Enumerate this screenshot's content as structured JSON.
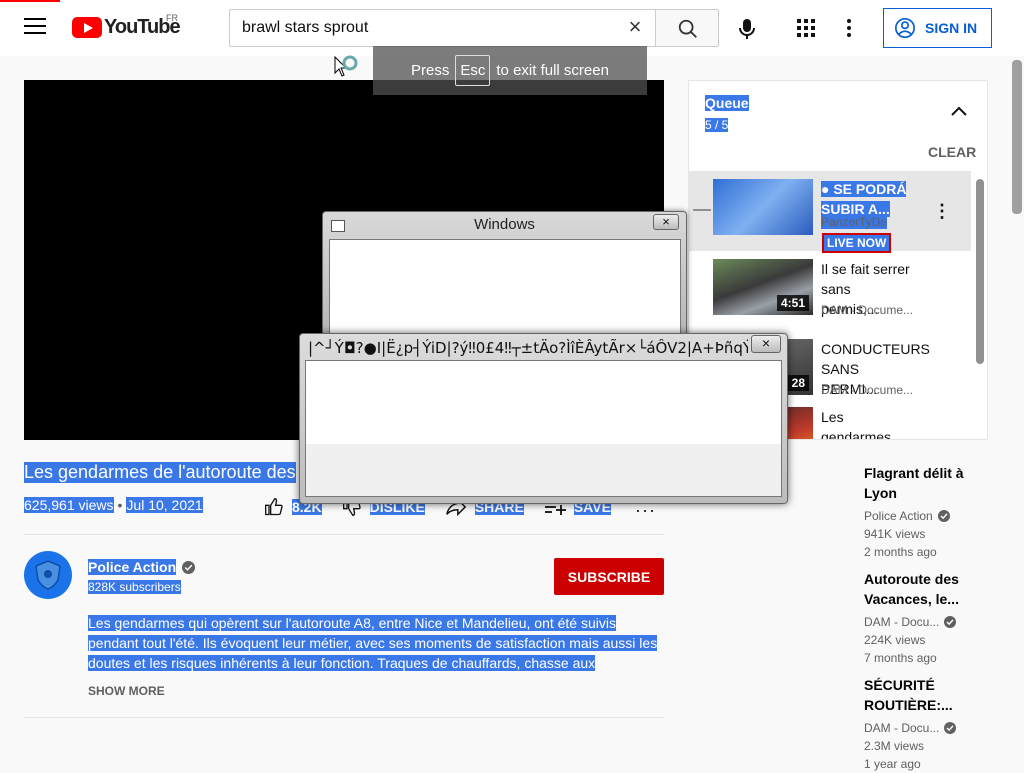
{
  "header": {
    "logo_text": "YouTube",
    "country_code": "FR",
    "search_value": "brawl stars sprout",
    "clear_glyph": "×",
    "sign_in": "SIGN IN",
    "icons": [
      "menu-icon",
      "search-icon",
      "mic-icon",
      "apps-icon",
      "more-vert-icon",
      "account-icon"
    ]
  },
  "fullscreen_hint": {
    "before": "Press",
    "key": "Esc",
    "after": "to exit full screen"
  },
  "video": {
    "title": "Les gendarmes de l'autoroute des",
    "views": "625,961 views",
    "separator": "•",
    "date": "Jul 10, 2021",
    "likes": "8.2K",
    "dislike": "DISLIKE",
    "share": "SHARE",
    "save": "SAVE",
    "more": "···"
  },
  "channel": {
    "name": "Police Action",
    "subscribers": "828K subscribers",
    "subscribe": "SUBSCRIBE"
  },
  "description": {
    "text": "Les gendarmes qui opèrent sur l'autoroute A8, entre Nice et Mandelieu, ont été suivis pendant tout l'été. Ils évoquent leur métier, avec ses moments de satisfaction mais aussi les doutes et les risques inhérents à leur fonction. Traques de chauffards, chasse aux",
    "show_more": "SHOW MORE"
  },
  "queue": {
    "title": "Queue",
    "count": "5 / 5",
    "clear": "CLEAR",
    "items": [
      {
        "title": "● SE PODRÁ SUBIR A...",
        "channel": "PanzerTyDe",
        "badge": "LIVE NOW",
        "duration": ""
      },
      {
        "title": "Il se fait serrer sans permis,...",
        "channel": "DAM - Docume...",
        "badge": "",
        "duration": "4:51"
      },
      {
        "title": "CONDUCTEURS SANS PERMI...",
        "channel": "DAM - Docume...",
        "badge": "",
        "duration": "28"
      },
      {
        "title": "Les gendarmes d...",
        "channel": "",
        "badge": "",
        "duration": ""
      }
    ]
  },
  "recommendations": [
    {
      "title": "Flagrant délit à Lyon",
      "channel": "Police Action",
      "views": "941K views",
      "age": "2 months ago"
    },
    {
      "title": "Autoroute des Vacances, le...",
      "channel": "DAM - Docu...",
      "views": "224K views",
      "age": "7 months ago"
    },
    {
      "title": "SÉCURITÉ ROUTIÈRE:...",
      "channel": "DAM - Docu...",
      "views": "2.3M views",
      "age": "1 year ago"
    }
  ],
  "dialogs": {
    "windows_title": "Windows",
    "garbled_title": "|^┘Ý◘?●I|Ë¿p┤ÝiD|?ý‼0£4‼┬±tÄo?ÌîÈÂytÃr×└áÔV2|A+ÞñqÝh.┬ä'\"...",
    "close_glyph": "×"
  },
  "colors": {
    "selection": "#3b78e7",
    "brand_red": "#ff0000",
    "subscribe_red": "#cc0000",
    "link_blue": "#065fd4"
  }
}
